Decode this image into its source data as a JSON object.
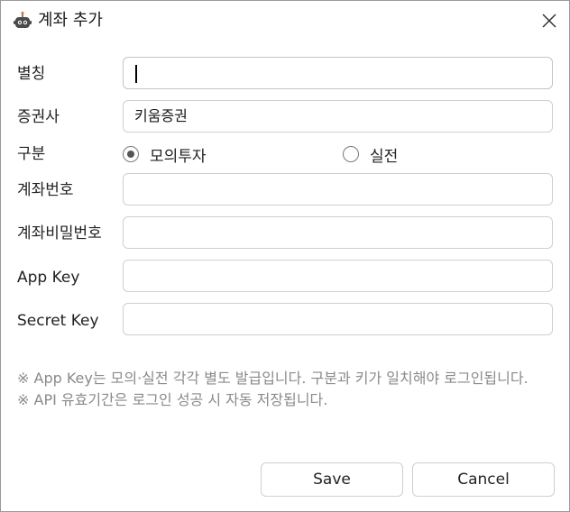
{
  "window": {
    "title": "계좌 추가"
  },
  "form": {
    "alias_label": "별칭",
    "alias_value": "",
    "broker_label": "증권사",
    "broker_value": "키움증권",
    "type_label": "구분",
    "type_options": [
      {
        "label": "모의투자",
        "selected": true
      },
      {
        "label": "실전",
        "selected": false
      }
    ],
    "account_label": "계좌번호",
    "account_value": "",
    "password_label": "계좌비밀번호",
    "password_value": "",
    "appkey_label": "App Key",
    "appkey_value": "",
    "secret_label": "Secret Key",
    "secret_value": ""
  },
  "notes": [
    "※ App Key는 모의·실전 각각 별도 발급입니다. 구분과 키가 일치해야 로그인됩니다.",
    "※ API 유효기간은 로그인 성공 시 자동 저장됩니다."
  ],
  "buttons": {
    "save": "Save",
    "cancel": "Cancel"
  }
}
